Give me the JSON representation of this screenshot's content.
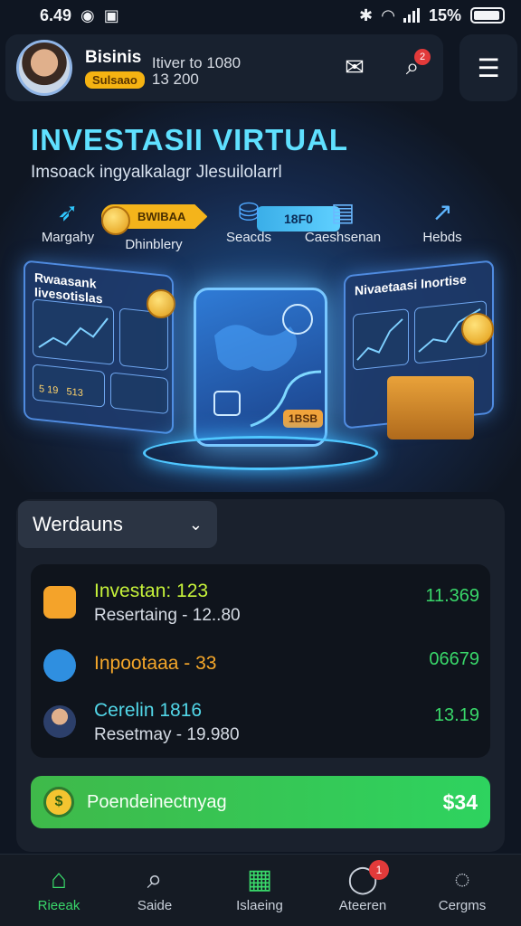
{
  "status_bar": {
    "time": "6.49",
    "battery": "15%"
  },
  "header": {
    "name": "Bisinis",
    "badge": "Sulsaao",
    "line1": "Itiver to 1080",
    "line2": "13 200",
    "notif_count": "2"
  },
  "hero": {
    "title": "INVESTASII VIRTUAL",
    "subtitle": "Imsoack ingyalkalagr Jlesuilolarrl",
    "categories": [
      {
        "label": "Margahy",
        "icon": "rocket-icon"
      },
      {
        "label": "Dhinblery",
        "icon": "coin-icon"
      },
      {
        "label": "Seacds",
        "icon": "database-icon"
      },
      {
        "label": "Caeshsenan",
        "icon": "document-icon"
      },
      {
        "label": "Hebds",
        "icon": "chart-up-icon"
      }
    ],
    "ribbon_left": "BWIBAA",
    "ribbon_right": "18F0",
    "left_panel_title": "Rwaasank Iivesotislas",
    "left_panel_values": [
      "5 19",
      "513"
    ],
    "right_panel_title": "Nivaetaasi Inortise",
    "center_card_value": "1BSB"
  },
  "section": {
    "dropdown_label": "Werdauns",
    "items": [
      {
        "title": "Investan: 123",
        "subtitle": "Resertaing - 12..80",
        "value": "11.369",
        "title_color": "#c6f23a",
        "icon": "briefcase-icon"
      },
      {
        "title": "Inpootaaa - 33",
        "subtitle": "",
        "value": "06679",
        "title_color": "#f5a72a",
        "icon": "chip-icon"
      },
      {
        "title": "Cerelin 1816",
        "subtitle": "Resetmay - 19.980",
        "value": "13.19",
        "title_color": "#52d7e8",
        "icon": "person-icon"
      }
    ],
    "cta_label": "Poendeinectnyag",
    "cta_amount": "$34",
    "cta_coin": "$"
  },
  "bottom_nav": [
    {
      "label": "Rieeak",
      "icon": "home-icon",
      "active": true
    },
    {
      "label": "Saide",
      "icon": "search-icon",
      "active": false
    },
    {
      "label": "Islaeing",
      "icon": "chart-icon",
      "active": false
    },
    {
      "label": "Ateeren",
      "icon": "bell-icon",
      "active": false,
      "badge": "1"
    },
    {
      "label": "Cergms",
      "icon": "chat-icon",
      "active": false
    }
  ],
  "colors": {
    "accent": "#39d86a",
    "title": "#5fe0ff",
    "badge": "#e23a3a"
  }
}
